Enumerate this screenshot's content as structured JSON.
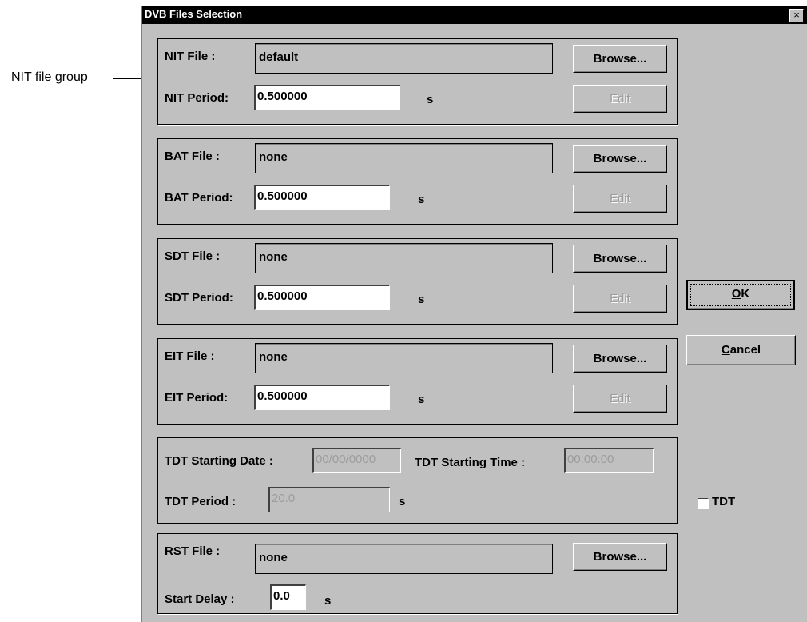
{
  "annotation": {
    "text": "NIT file group"
  },
  "dialog": {
    "title": "DVB Files Selection",
    "close_icon": "×"
  },
  "nit": {
    "file_label": "NIT File :",
    "file_value": "default",
    "browse_label": "Browse...",
    "period_label": "NIT Period:",
    "period_value": "0.500000",
    "unit": "s",
    "edit_label": "Edit"
  },
  "bat": {
    "file_label": "BAT File :",
    "file_value": "none",
    "browse_label": "Browse...",
    "period_label": "BAT Period:",
    "period_value": "0.500000",
    "unit": "s",
    "edit_label": "Edit"
  },
  "sdt": {
    "file_label": "SDT File :",
    "file_value": "none",
    "browse_label": "Browse...",
    "period_label": "SDT Period:",
    "period_value": "0.500000",
    "unit": "s",
    "edit_label": "Edit"
  },
  "eit": {
    "file_label": "EIT File :",
    "file_value": "none",
    "browse_label": "Browse...",
    "period_label": "EIT Period:",
    "period_value": "0.500000",
    "unit": "s",
    "edit_label": "Edit"
  },
  "tdt": {
    "date_label": "TDT Starting Date :",
    "date_value": "00/00/0000",
    "time_label": "TDT Starting Time :",
    "time_value": "00:00:00",
    "period_label": "TDT Period :",
    "period_value": "20.0",
    "unit": "s",
    "checkbox_label": "TDT",
    "checked": false
  },
  "rst": {
    "file_label": "RST File :",
    "file_value": "none",
    "browse_label": "Browse...",
    "delay_label": "Start Delay :",
    "delay_value": "0.0",
    "unit": "s"
  },
  "buttons": {
    "ok_mnemonic": "O",
    "ok_rest": "K",
    "cancel_mnemonic": "C",
    "cancel_rest": "ancel"
  }
}
